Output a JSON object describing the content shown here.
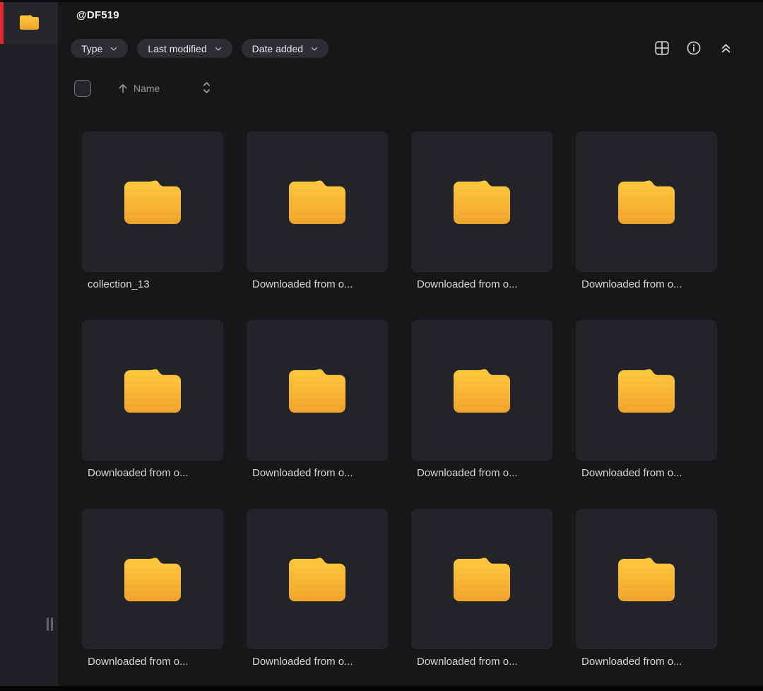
{
  "window": {
    "title": "@DF519"
  },
  "colors": {
    "content_bg": "#161719",
    "sidebar_bg": "#212226",
    "sidebar_tile_bg": "#26272c",
    "card_bg": "#222429",
    "chip_bg": "#2c2e32",
    "accent_red": "#e8252c",
    "folder_gradient_top": "#ffc93e",
    "folder_gradient_bottom": "#f0a42c",
    "text_primary": "#f3f4f6",
    "text_secondary": "#96979a",
    "text_label": "#d5d6d8",
    "icon_color": "#d9dadc"
  },
  "sidebar": {
    "active_item": {
      "icon": "folder-icon",
      "selected": true,
      "indicator_color": "#e8252c"
    },
    "resize_handle": "drag-handle"
  },
  "header": {
    "title": "@DF519",
    "filters": [
      {
        "label": "Type",
        "icon": "chevron-down-icon"
      },
      {
        "label": "Last modified",
        "icon": "chevron-down-icon"
      },
      {
        "label": "Date added",
        "icon": "chevron-down-icon"
      }
    ],
    "actions": [
      {
        "name": "grid-view-icon"
      },
      {
        "name": "info-icon"
      },
      {
        "name": "collapse-up-icon"
      }
    ]
  },
  "list_controls": {
    "select_all": {
      "checked": false
    },
    "sort": {
      "field": "Name",
      "direction": "ascending",
      "icon": "up-down-chevrons-icon"
    }
  },
  "grid": {
    "item_type": "folder",
    "items": [
      {
        "label": "collection_13"
      },
      {
        "label": "Downloaded from o..."
      },
      {
        "label": "Downloaded from o..."
      },
      {
        "label": "Downloaded from o..."
      },
      {
        "label": "Downloaded from o..."
      },
      {
        "label": "Downloaded from o..."
      },
      {
        "label": "Downloaded from o..."
      },
      {
        "label": "Downloaded from o..."
      },
      {
        "label": "Downloaded from o..."
      },
      {
        "label": "Downloaded from o..."
      },
      {
        "label": "Downloaded from o..."
      },
      {
        "label": "Downloaded from o..."
      }
    ]
  }
}
